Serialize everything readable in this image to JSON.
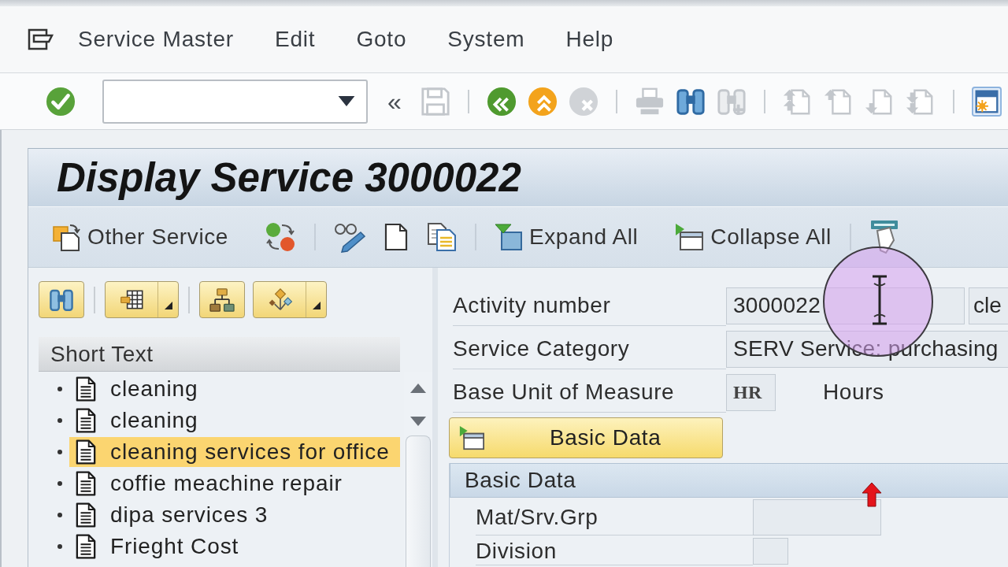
{
  "menu_bar": {
    "items": [
      {
        "label": "Service Master"
      },
      {
        "label": "Edit"
      },
      {
        "label": "Goto"
      },
      {
        "label": "System"
      },
      {
        "label": "Help"
      }
    ]
  },
  "toolbar": {
    "groups": [
      [
        {
          "kind": "enter",
          "disabled": false
        },
        {
          "kind": "command",
          "disabled": false
        },
        {
          "kind": "toggle",
          "label": "«",
          "disabled": false
        },
        {
          "kind": "save",
          "disabled": true
        }
      ],
      [
        {
          "kind": "back",
          "disabled": false
        },
        {
          "kind": "exit",
          "disabled": false
        },
        {
          "kind": "cancel",
          "disabled": true
        }
      ],
      [
        {
          "kind": "print",
          "disabled": true
        },
        {
          "kind": "find",
          "disabled": false
        },
        {
          "kind": "find-next",
          "disabled": true
        }
      ],
      [
        {
          "kind": "first",
          "disabled": true
        },
        {
          "kind": "previous",
          "disabled": true
        },
        {
          "kind": "next",
          "disabled": true
        },
        {
          "kind": "last",
          "disabled": true
        }
      ],
      [
        {
          "kind": "layout",
          "disabled": false
        }
      ]
    ]
  },
  "title": "Display Service 3000022",
  "app_toolbar": {
    "groups": [
      [
        {
          "kind": "other-service",
          "label": "Other Service"
        },
        {
          "kind": "switch"
        }
      ],
      [
        {
          "kind": "display-change"
        },
        {
          "kind": "create"
        },
        {
          "kind": "copy"
        }
      ],
      [
        {
          "kind": "expand",
          "label": "Expand All"
        },
        {
          "kind": "collapse",
          "label": "Collapse All"
        }
      ],
      [
        {
          "kind": "tray"
        }
      ]
    ]
  },
  "tree_toolbar": {
    "groups": [
      [
        {
          "kind": "find",
          "dropdown": false
        }
      ],
      [
        {
          "kind": "layout",
          "dropdown": true
        }
      ],
      [
        {
          "kind": "hierarchy",
          "dropdown": false
        },
        {
          "kind": "nodes",
          "dropdown": true
        }
      ]
    ]
  },
  "service_list": {
    "column": "Short Text",
    "items": [
      {
        "label": "cleaning",
        "selected": false
      },
      {
        "label": "cleaning",
        "selected": false
      },
      {
        "label": "cleaning services for office",
        "selected": true
      },
      {
        "label": "coffie meachine repair",
        "selected": false
      },
      {
        "label": "dipa services 3",
        "selected": false
      },
      {
        "label": "Frieght Cost",
        "selected": false
      }
    ]
  },
  "header_fields": [
    {
      "kind": "number",
      "label": "Activity number",
      "value": "3000022",
      "description": "cle"
    },
    {
      "kind": "category",
      "label": "Service Category",
      "value": "SERV Service: purchasing"
    },
    {
      "kind": "unit",
      "label": "Base Unit of Measure",
      "value": "HR",
      "description": "Hours"
    }
  ],
  "section_button": {
    "label": "Basic Data"
  },
  "basic_data": {
    "title": "Basic Data",
    "fields": [
      {
        "kind": "code",
        "label": "Mat/Srv.Grp"
      },
      {
        "kind": "flag",
        "label": "Division"
      }
    ]
  }
}
